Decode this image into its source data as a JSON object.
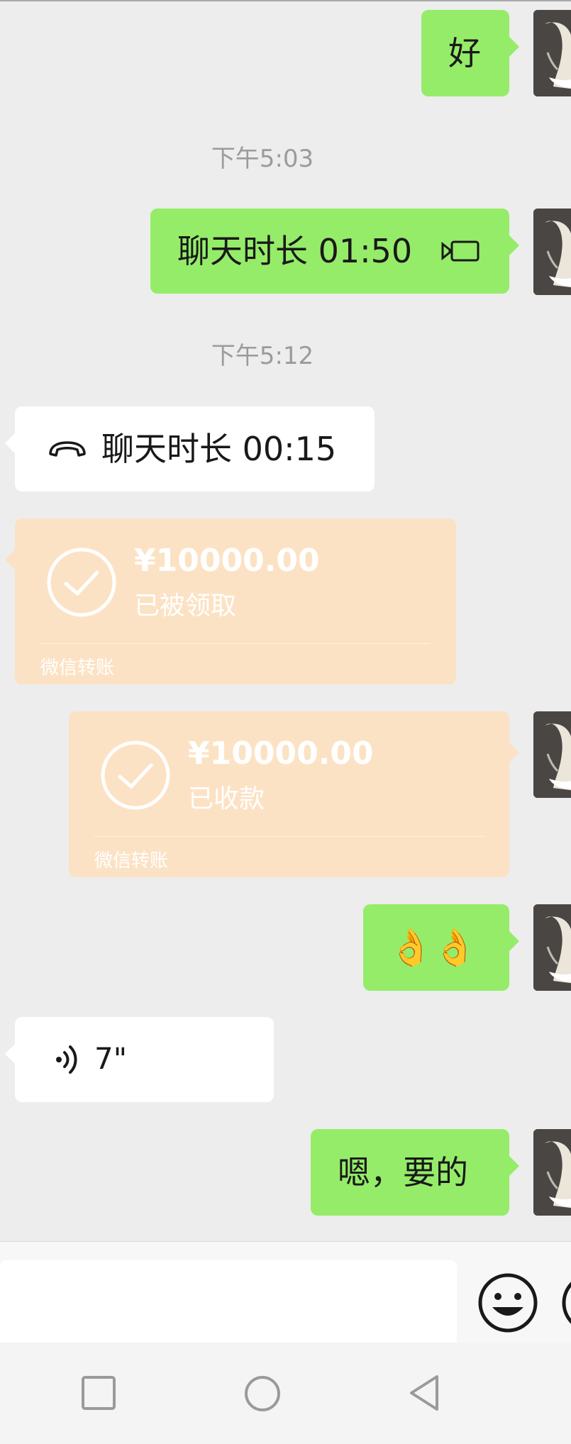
{
  "chat": {
    "messages": {
      "hao": {
        "text": "好"
      },
      "time1": "下午5:03",
      "video_call": {
        "text": "聊天时长 01:50"
      },
      "time2": "下午5:12",
      "voice_call": {
        "text": "聊天时长 00:15"
      },
      "transfer_received": {
        "amount": "¥10000.00",
        "status": "已被领取",
        "footer": "微信转账"
      },
      "transfer_collected": {
        "amount": "¥10000.00",
        "status": "已收款",
        "footer": "微信转账"
      },
      "emoji_msg": {
        "text": "👌👌"
      },
      "voice_msg": {
        "duration": "7\""
      },
      "last_msg": {
        "text": "嗯，要的"
      }
    }
  },
  "input_bar": {
    "placeholder": ""
  },
  "colors": {
    "background": "#ededed",
    "sent_bubble": "#95ec69",
    "received_bubble": "#ffffff",
    "transfer_card": "#fce2c4",
    "timestamp": "#9b9b9b"
  },
  "icons": [
    "video-call-icon",
    "phone-icon",
    "check-circle-icon",
    "voice-wave-icon",
    "emoji-icon",
    "square-nav-icon",
    "circle-nav-icon",
    "back-nav-icon"
  ]
}
